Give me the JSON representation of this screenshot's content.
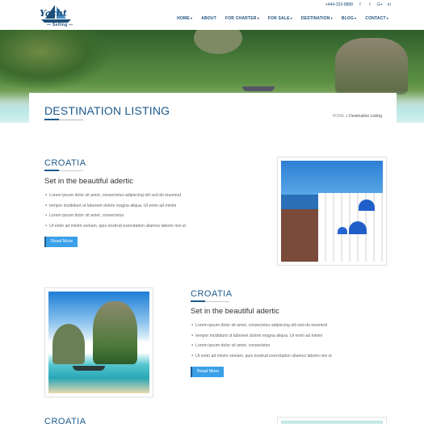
{
  "brand": {
    "logo_title": "Yacht",
    "logo_sub": "— Selling —"
  },
  "topbar": {
    "phone": "+444-333-8888",
    "social": [
      {
        "glyph": "f",
        "icon": "facebook-icon"
      },
      {
        "glyph": "t",
        "icon": "twitter-icon"
      },
      {
        "glyph": "G+",
        "icon": "googleplus-icon"
      },
      {
        "glyph": "in",
        "icon": "linkedin-icon"
      }
    ]
  },
  "nav": {
    "items": [
      {
        "label": "HOME",
        "caret": true
      },
      {
        "label": "ABOUT",
        "caret": false
      },
      {
        "label": "FOR CHARTER",
        "caret": true
      },
      {
        "label": "FOR SALE",
        "caret": true
      },
      {
        "label": "DESTINATION",
        "caret": true
      },
      {
        "label": "BLOG",
        "caret": true
      },
      {
        "label": "CONTACT",
        "caret": true
      }
    ]
  },
  "page": {
    "title": "DESTINATION LISTING",
    "breadcrumb": {
      "home": "HOME",
      "separator": "»",
      "current": "Destination Listing"
    }
  },
  "listings": [
    {
      "title": "CROATIA",
      "subtitle": "Set in the beautiful adertic",
      "bullets": [
        "Lorem ipsum dolor sit amet, consectetur adipiscing elit sed do eiusmod",
        "tempor incididunt ut laboreet dolore magna aliqua. Ut enim ad minim",
        "Lorem ipsum dolor sit amet, consectetur",
        "Ut enim ad minim veniam, quis nostrud exercitation ullamco laboris nisi ut"
      ],
      "button": "Read More"
    },
    {
      "title": "CROATIA",
      "subtitle": "Set in the beautiful adertic",
      "bullets": [
        "Lorem ipsum dolor sit amet, consectetur adipiscing elit sed do eiusmod",
        "tempor incididunt ut laboreet dolore magna aliqua. Ut enim ad minim",
        "Lorem ipsum dolor sit amet, consectetur",
        "Ut enim ad minim veniam, quis nostrud exercitation ullamco laboris nisi ut"
      ],
      "button": "Read More"
    },
    {
      "title": "CROATIA"
    }
  ]
}
